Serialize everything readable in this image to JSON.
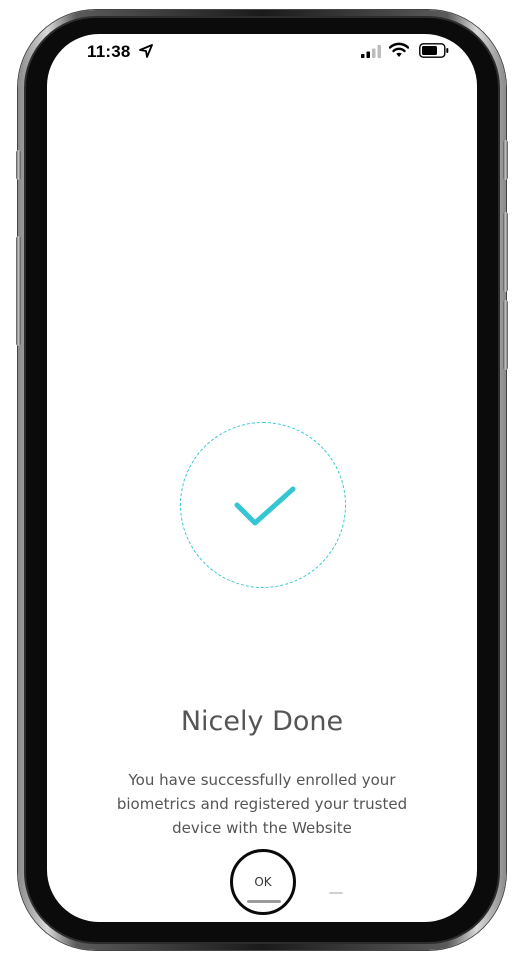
{
  "status_bar": {
    "time": "11:38",
    "location_icon": "location-arrow-icon",
    "signal_icon": "cellular-signal-icon",
    "wifi_icon": "wifi-icon",
    "battery_icon": "battery-icon"
  },
  "success": {
    "icon": "checkmark-icon",
    "accent_color": "#35c6d3",
    "title": "Nicely Done",
    "message": "You have successfully enrolled your biometrics and registered your trusted device with the Website"
  },
  "actions": {
    "ok_label": "OK"
  }
}
